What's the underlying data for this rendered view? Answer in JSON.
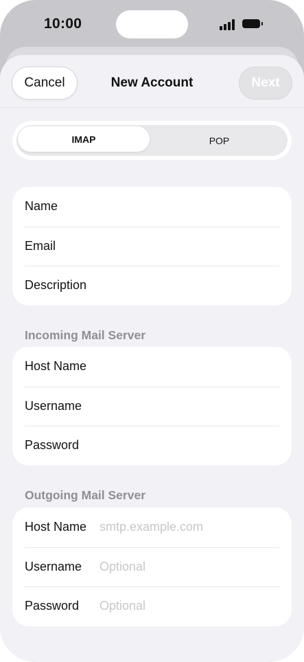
{
  "status_bar": {
    "time": "10:00"
  },
  "nav": {
    "cancel_label": "Cancel",
    "title": "New Account",
    "next_label": "Next"
  },
  "segmented": {
    "options": [
      "IMAP",
      "POP"
    ],
    "selected": "IMAP"
  },
  "account": {
    "rows": [
      {
        "label": "Name",
        "value": ""
      },
      {
        "label": "Email",
        "value": ""
      },
      {
        "label": "Description",
        "value": ""
      }
    ]
  },
  "incoming": {
    "header": "Incoming Mail Server",
    "rows": [
      {
        "label": "Host Name",
        "value": ""
      },
      {
        "label": "Username",
        "value": ""
      },
      {
        "label": "Password",
        "value": ""
      }
    ]
  },
  "outgoing": {
    "header": "Outgoing Mail Server",
    "rows": [
      {
        "label": "Host Name",
        "placeholder": "smtp.example.com"
      },
      {
        "label": "Username",
        "placeholder": "Optional"
      },
      {
        "label": "Password",
        "placeholder": "Optional"
      }
    ]
  },
  "colors": {
    "sheet_bg": "#f2f1f6",
    "placeholder": "#c7c7cc",
    "section_header": "#8e8e93"
  }
}
